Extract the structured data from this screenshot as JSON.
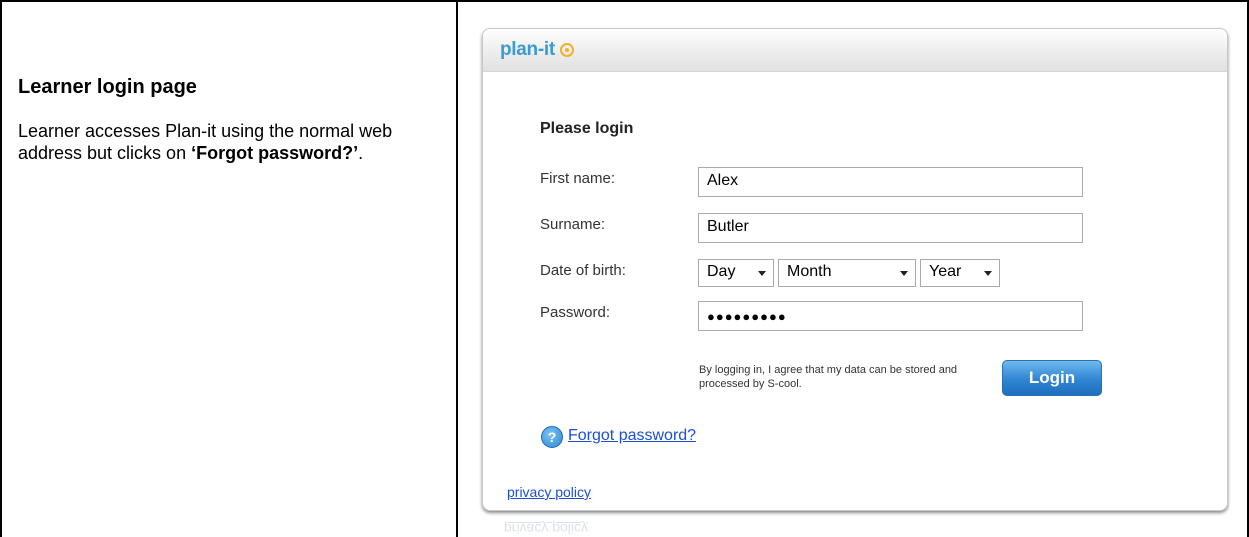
{
  "doc": {
    "title": "Learner login page",
    "body_text": "Learner accesses Plan-it using the normal web address but clicks on ",
    "body_bold": "‘Forgot password?’",
    "body_end": "."
  },
  "app": {
    "logo": "plan-it",
    "form_title": "Please login",
    "labels": {
      "first_name": "First name:",
      "surname": "Surname:",
      "dob": "Date of birth:",
      "password": "Password:"
    },
    "values": {
      "first_name": "Alex",
      "surname": "Butler",
      "password_masked": "●●●●●●●●●"
    },
    "dob": {
      "day": "Day",
      "month": "Month",
      "year": "Year"
    },
    "consent": "By logging in, I agree that my data can be stored and processed by S-cool.",
    "login_label": "Login",
    "forgot_label": "Forgot password?",
    "privacy_label": "privacy policy",
    "icons": {
      "help": "help-question-icon"
    },
    "colors": {
      "logo": "#3a9ccf",
      "link": "#1a4fd6",
      "button": "#2f86d3"
    }
  }
}
